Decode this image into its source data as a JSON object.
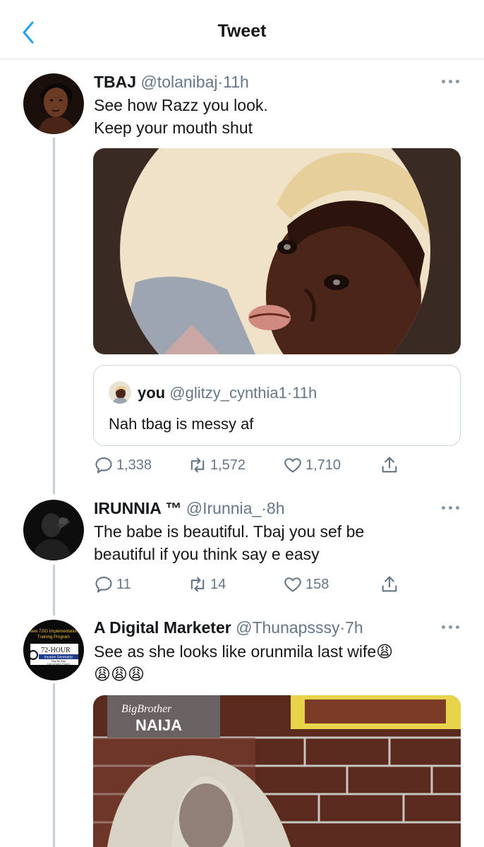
{
  "header": {
    "title": "Tweet",
    "back_icon": "chevron-left-icon"
  },
  "tweets": [
    {
      "name": "TBAJ",
      "handle": "@tolanibaj",
      "dot": "·",
      "time": "11h",
      "text_lines": [
        "See how Razz you look.",
        "Keep your mouth shut"
      ],
      "quote": {
        "name": "you",
        "handle": "@glitzy_cynthia1",
        "dot": "·",
        "time": "11h",
        "text": "Nah tbag is messy af"
      },
      "actions": {
        "replies": "1,338",
        "retweets": "1,572",
        "likes": "1,710"
      }
    },
    {
      "name": "IRUNNIA ™",
      "handle": "@Irunnia_",
      "dot": "·",
      "time": "8h",
      "text_lines": [
        "The babe is beautiful. Tbaj you sef be",
        "beautiful if you think say e easy"
      ],
      "actions": {
        "replies": "11",
        "retweets": "14",
        "likes": "158"
      }
    },
    {
      "name": "A Digital Marketer",
      "handle": "@Thunapsssy",
      "dot": "·",
      "time": "7h",
      "text_lines": [
        "See as she looks like orunmila last wife😩",
        "😩😩😩"
      ],
      "avatar_text": {
        "line1": "New 72IG Implementation",
        "line2": "Training Program",
        "line3": "72-HOUR",
        "line4": "Income Generator",
        "line5": "Step By Step",
        "line6": "Implementation Program"
      },
      "media_sign": {
        "line1": "BigBrother",
        "line2": "NAIJA"
      }
    }
  ],
  "colors": {
    "accent": "#1da1f2",
    "muted": "#657786",
    "border": "#e1e8ed",
    "thread_line": "#c4cfd6"
  }
}
